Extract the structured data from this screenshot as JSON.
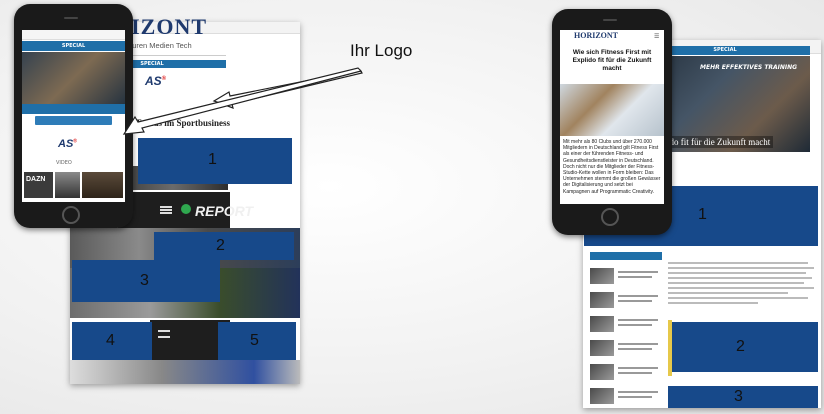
{
  "annotation": {
    "logo_label": "Ihr Logo"
  },
  "ad_slots": {
    "left": [
      "1",
      "2",
      "3",
      "4",
      "5"
    ],
    "right": [
      "1",
      "2",
      "3"
    ]
  },
  "left_desktop": {
    "brand": "HORIZONT",
    "nav": "Marketing  Agenturen  Medien  Tech",
    "special_label": "SPECIAL",
    "sponsor_logo": "AS",
    "headline": "Marken, Trends im Sportbusiness",
    "report_label": "REPORT"
  },
  "left_phone": {
    "special_label": "SPECIAL",
    "sponsor_logo": "AS",
    "video_label": "VIDEO",
    "thumb_text": "DAZN"
  },
  "right_desktop": {
    "special_label": "SPECIAL",
    "hero_label": "MEHR EFFEKTIVES TRAINING",
    "hero_caption": "First mit Explido fit für die Zukunft macht"
  },
  "right_phone": {
    "brand": "HORIZONT",
    "headline": "Wie sich Fitness First mit Explido fit für die Zukunft macht",
    "body": "Mit mehr als 80 Clubs und über 270.000 Mitgliedern in Deutschland gilt Fitness First als einer der führenden Fitness- und Gesundheitsdienstleister in Deutschland. Doch nicht nur die Mitglieder der Fitness-Studio-Kette wollen in Form bleiben: Das Unternehmen stemmt die großen Gewässer der Digitalisierung und setzt bei Kampagnen auf Programmatic Creativity."
  },
  "colors": {
    "ad_slot": "#17498a",
    "brand_blue": "#1f6fa8",
    "logo_navy": "#1f3a6e"
  }
}
